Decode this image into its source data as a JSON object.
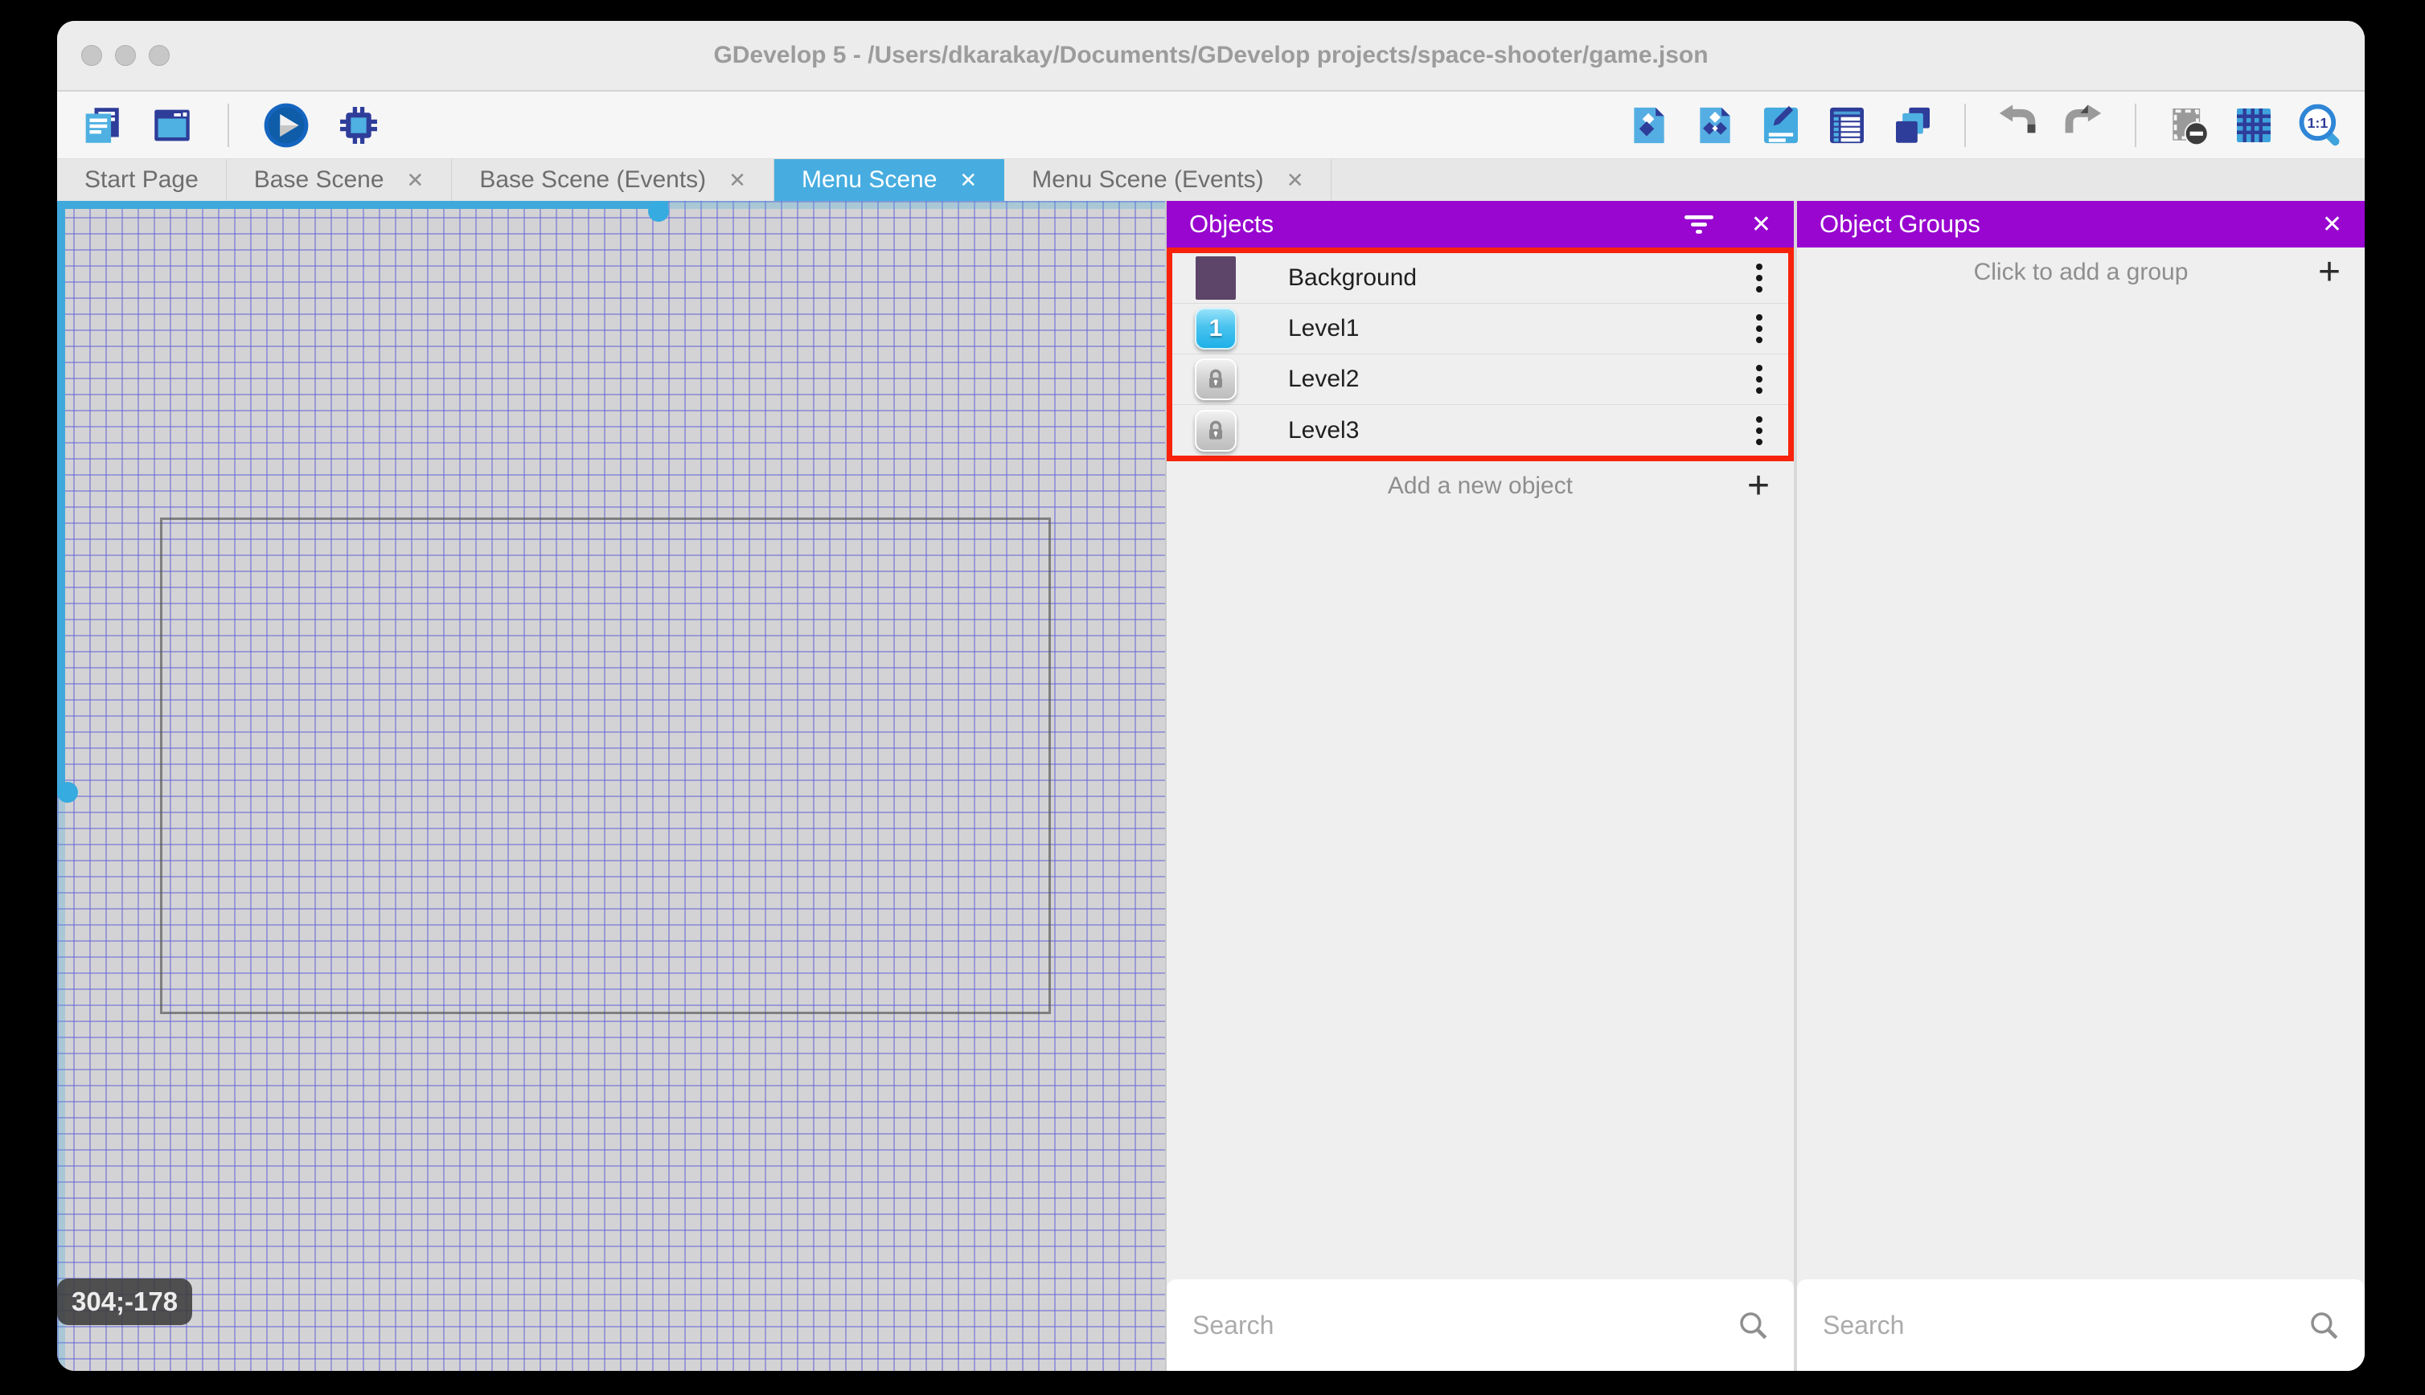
{
  "window": {
    "title": "GDevelop 5 - /Users/dkarakay/Documents/GDevelop projects/space-shooter/game.json"
  },
  "toolbar": {
    "left_icons": [
      "project-manager-icon",
      "preview-window-icon",
      "play-icon",
      "debug-icon"
    ],
    "right_icons": [
      "add-object-icon",
      "object-groups-icon",
      "edit-properties-icon",
      "instances-list-icon",
      "layers-icon",
      "undo-icon",
      "redo-icon",
      "toggle-mask-icon",
      "grid-icon",
      "zoom-1-1-icon"
    ]
  },
  "tabs": [
    {
      "label": "Start Page",
      "closable": false,
      "active": false
    },
    {
      "label": "Base Scene",
      "closable": true,
      "active": false
    },
    {
      "label": "Base Scene (Events)",
      "closable": true,
      "active": false
    },
    {
      "label": "Menu Scene",
      "closable": true,
      "active": true
    },
    {
      "label": "Menu Scene (Events)",
      "closable": true,
      "active": false
    }
  ],
  "canvas": {
    "cursor_coordinates": "304;-178"
  },
  "objects_panel": {
    "title": "Objects",
    "items": [
      {
        "label": "Background",
        "icon": "background-color-swatch"
      },
      {
        "label": "Level1",
        "icon": "level1-button",
        "badge": "1"
      },
      {
        "label": "Level2",
        "icon": "locked-level-button"
      },
      {
        "label": "Level3",
        "icon": "locked-level-button"
      }
    ],
    "add_button_label": "Add a new object",
    "search_placeholder": "Search"
  },
  "groups_panel": {
    "title": "Object Groups",
    "empty_message": "Click to add a group",
    "search_placeholder": "Search"
  },
  "glyphs": {
    "close": "✕",
    "plus": "+"
  },
  "colors": {
    "panel_header_purple": "#9806cf",
    "highlight_red": "#f7230c",
    "active_tab_blue": "#47ade0",
    "scrollbar_blue": "#3fa9dc",
    "canvas_grid_blue": "#6262d8",
    "icon_navy": "#2e3d99",
    "icon_light_blue": "#4fb0e2"
  }
}
